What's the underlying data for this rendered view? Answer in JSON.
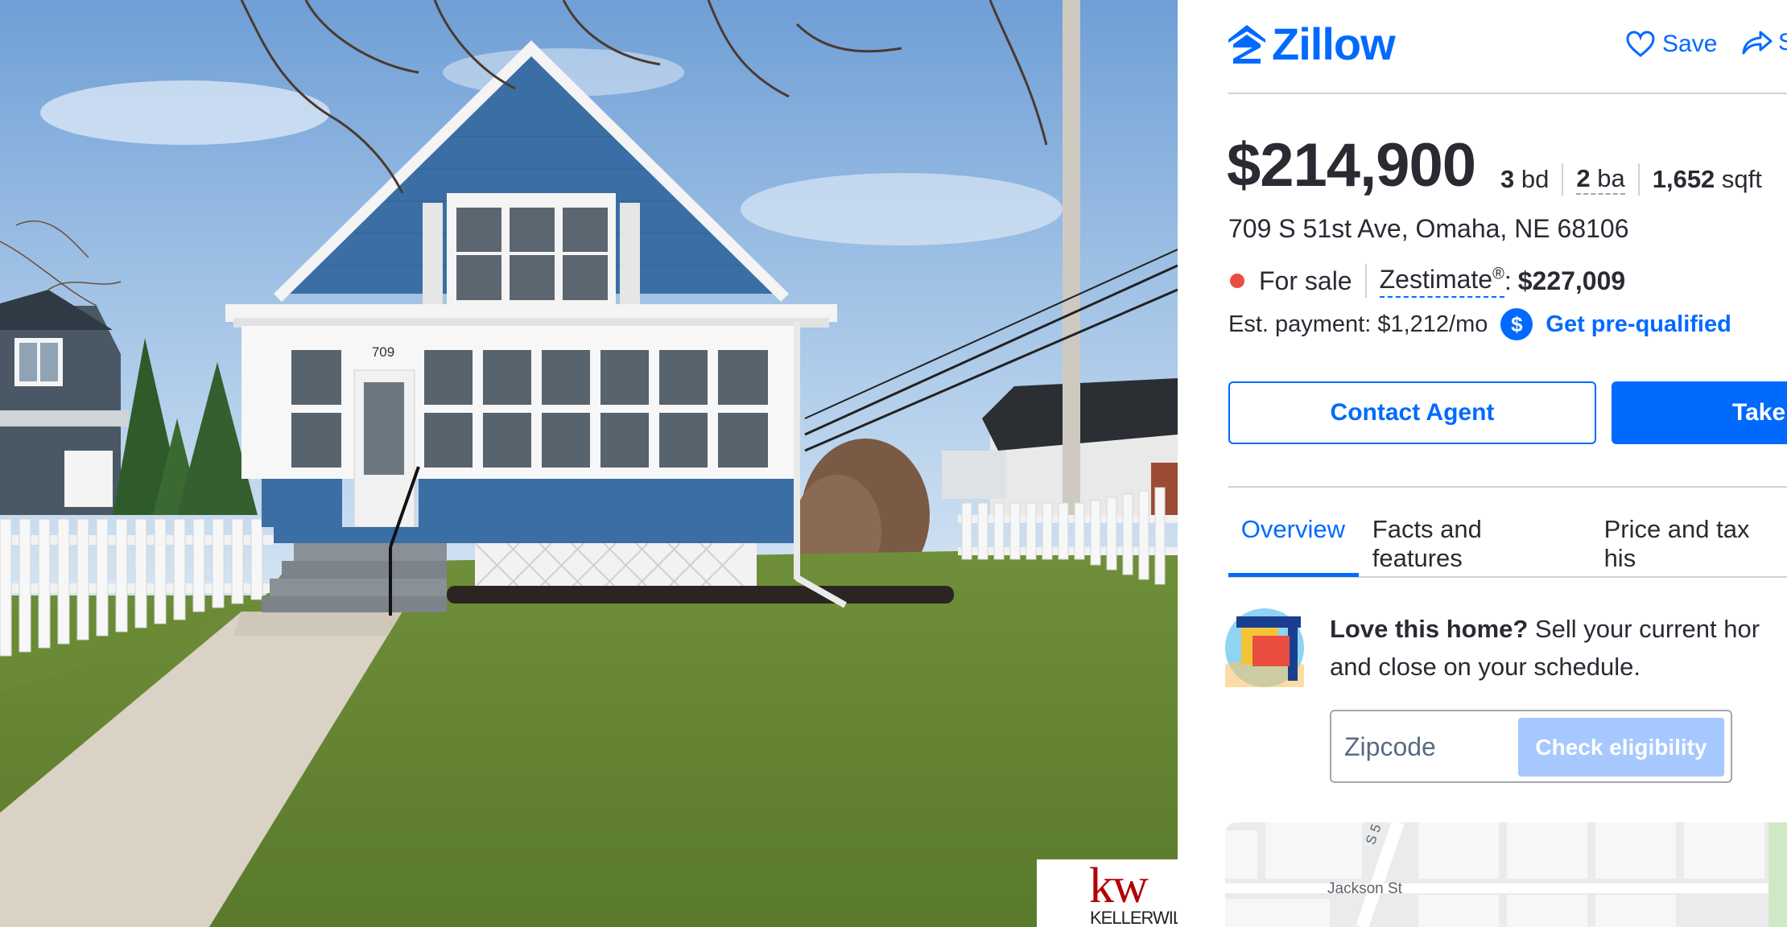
{
  "header": {
    "brand": "Zillow",
    "save_label": "Save",
    "share_label": "S"
  },
  "listing": {
    "price": "$214,900",
    "beds_value": "3",
    "beds_unit": "bd",
    "baths_value": "2",
    "baths_unit": "ba",
    "sqft_value": "1,652",
    "sqft_unit": "sqft",
    "address": "709 S 51st Ave, Omaha, NE 68106",
    "status": "For sale",
    "zestimate_label": "Zestimate",
    "zestimate_reg": "®",
    "zestimate_colon": ":",
    "zestimate_value": "$227,009",
    "payment_label": "Est. payment: $1,212/mo",
    "prequal_link": "Get pre-qualified"
  },
  "actions": {
    "contact_agent": "Contact Agent",
    "take_tour": "Take"
  },
  "tabs": [
    {
      "label": "Overview",
      "active": true
    },
    {
      "label": "Facts and features",
      "active": false
    },
    {
      "label": "Price and tax his",
      "active": false
    }
  ],
  "promo": {
    "bold": "Love this home?",
    "line1_rest": " Sell your current hor",
    "line2": "and close on your schedule.",
    "zip_placeholder": "Zipcode",
    "check_button": "Check eligibility"
  },
  "photo": {
    "house_number": "709",
    "agency_mark": "kw",
    "agency_text": "KELLERWIL"
  },
  "map": {
    "street_1": "Jackson St",
    "street_2": "S 5"
  },
  "colors": {
    "brand_blue": "#006aff",
    "status_red": "#e94e40",
    "text_dark": "#2a2a33",
    "disabled_button": "#a6c8ff",
    "house_siding": "#3a6ea5"
  },
  "icons": {
    "logo": "zillow-house-icon",
    "save": "heart-outline-icon",
    "share": "share-arrow-icon",
    "payment": "dollar-circle-icon",
    "promo": "sell-home-illustration-icon"
  }
}
